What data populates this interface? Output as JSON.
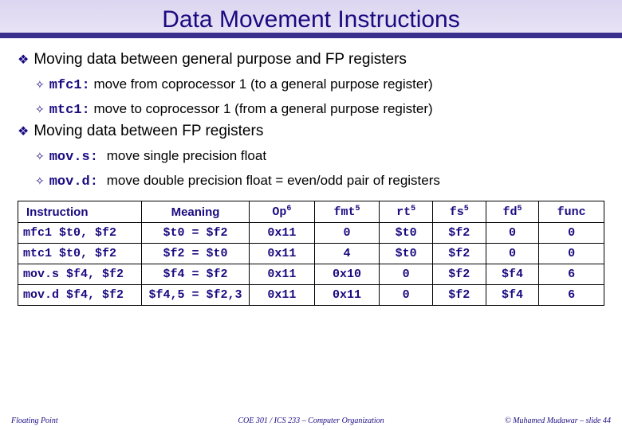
{
  "title": "Data Movement Instructions",
  "b1": "Moving data between general purpose and FP registers",
  "b1a_kw": "mfc1:",
  "b1a_txt": " move from coprocessor 1 (to a general purpose register)",
  "b1b_kw": "mtc1:",
  "b1b_txt": " move to coprocessor 1 (from a general purpose register)",
  "b2": "Moving data between FP registers",
  "b2a_kw": "mov.s:",
  "b2a_txt": "move single precision float",
  "b2b_kw": "mov.d:",
  "b2b_txt": "move double precision float = even/odd pair of registers",
  "headers": {
    "instr": "Instruction",
    "meaning": "Meaning",
    "op": "Op",
    "op_sup": "6",
    "fmt": "fmt",
    "fmt_sup": "5",
    "rt": "rt",
    "rt_sup": "5",
    "fs": "fs",
    "fs_sup": "5",
    "fd": "fd",
    "fd_sup": "5",
    "func": "func"
  },
  "rows": [
    {
      "instr": "mfc1  $t0, $f2",
      "mean": "$t0 = $f2",
      "op": "0x11",
      "fmt": "0",
      "rt": "$t0",
      "fs": "$f2",
      "fd": "0",
      "func": "0"
    },
    {
      "instr": "mtc1  $t0, $f2",
      "mean": "$f2 = $t0",
      "op": "0x11",
      "fmt": "4",
      "rt": "$t0",
      "fs": "$f2",
      "fd": "0",
      "func": "0"
    },
    {
      "instr": "mov.s $f4, $f2",
      "mean": "$f4 = $f2",
      "op": "0x11",
      "fmt": "0x10",
      "rt": "0",
      "fs": "$f2",
      "fd": "$f4",
      "func": "6"
    },
    {
      "instr": "mov.d $f4, $f2",
      "mean": "$f4,5 = $f2,3",
      "op": "0x11",
      "fmt": "0x11",
      "rt": "0",
      "fs": "$f2",
      "fd": "$f4",
      "func": "6"
    }
  ],
  "footer": {
    "left": "Floating Point",
    "center": "COE 301 / ICS 233 – Computer Organization",
    "right": "© Muhamed Mudawar – slide 44"
  }
}
